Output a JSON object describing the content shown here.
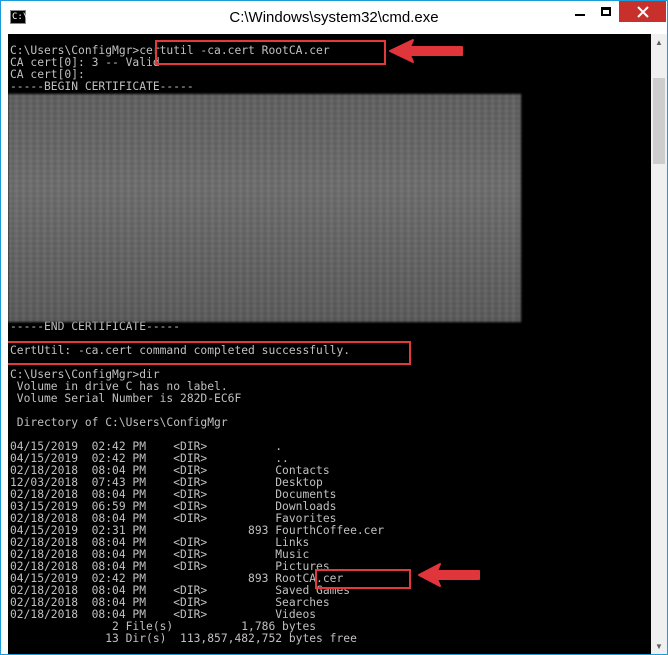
{
  "window": {
    "title": "C:\\Windows\\system32\\cmd.exe",
    "icon_label": "C:\\"
  },
  "terminal": {
    "lines": [
      "C:\\Users\\ConfigMgr>certutil -ca.cert RootCA.cer",
      "CA cert[0]: 3 -- Valid",
      "CA cert[0]:",
      "-----BEGIN CERTIFICATE-----",
      "",
      "",
      "",
      "",
      "",
      "",
      "",
      "",
      "",
      "",
      "",
      "",
      "",
      "",
      "",
      "",
      "",
      "",
      "",
      "-----END CERTIFICATE-----",
      "",
      "CertUtil: -ca.cert command completed successfully.",
      "",
      "C:\\Users\\ConfigMgr>dir",
      " Volume in drive C has no label.",
      " Volume Serial Number is 282D-EC6F",
      "",
      " Directory of C:\\Users\\ConfigMgr",
      "",
      "04/15/2019  02:42 PM    <DIR>          .",
      "04/15/2019  02:42 PM    <DIR>          ..",
      "02/18/2018  08:04 PM    <DIR>          Contacts",
      "12/03/2018  07:43 PM    <DIR>          Desktop",
      "02/18/2018  08:04 PM    <DIR>          Documents",
      "03/15/2019  06:59 PM    <DIR>          Downloads",
      "02/18/2018  08:04 PM    <DIR>          Favorites",
      "04/15/2019  02:31 PM               893 FourthCoffee.cer",
      "02/18/2018  08:04 PM    <DIR>          Links",
      "02/18/2018  08:04 PM    <DIR>          Music",
      "02/18/2018  08:04 PM    <DIR>          Pictures",
      "04/15/2019  02:42 PM               893 RootCA.cer",
      "02/18/2018  08:04 PM    <DIR>          Saved Games",
      "02/18/2018  08:04 PM    <DIR>          Searches",
      "02/18/2018  08:04 PM    <DIR>          Videos",
      "               2 File(s)          1,786 bytes",
      "              13 Dir(s)  113,857,482,752 bytes free"
    ]
  },
  "colors": {
    "console_bg": "#000000",
    "console_text": "#c0c0c0",
    "highlight": "#e03a3a",
    "close_button": "#c7302b"
  },
  "icons": [
    "cmd-icon",
    "minimize-icon",
    "maximize-icon",
    "close-icon",
    "scroll-up-icon",
    "scroll-down-icon",
    "arrow-icon"
  ]
}
